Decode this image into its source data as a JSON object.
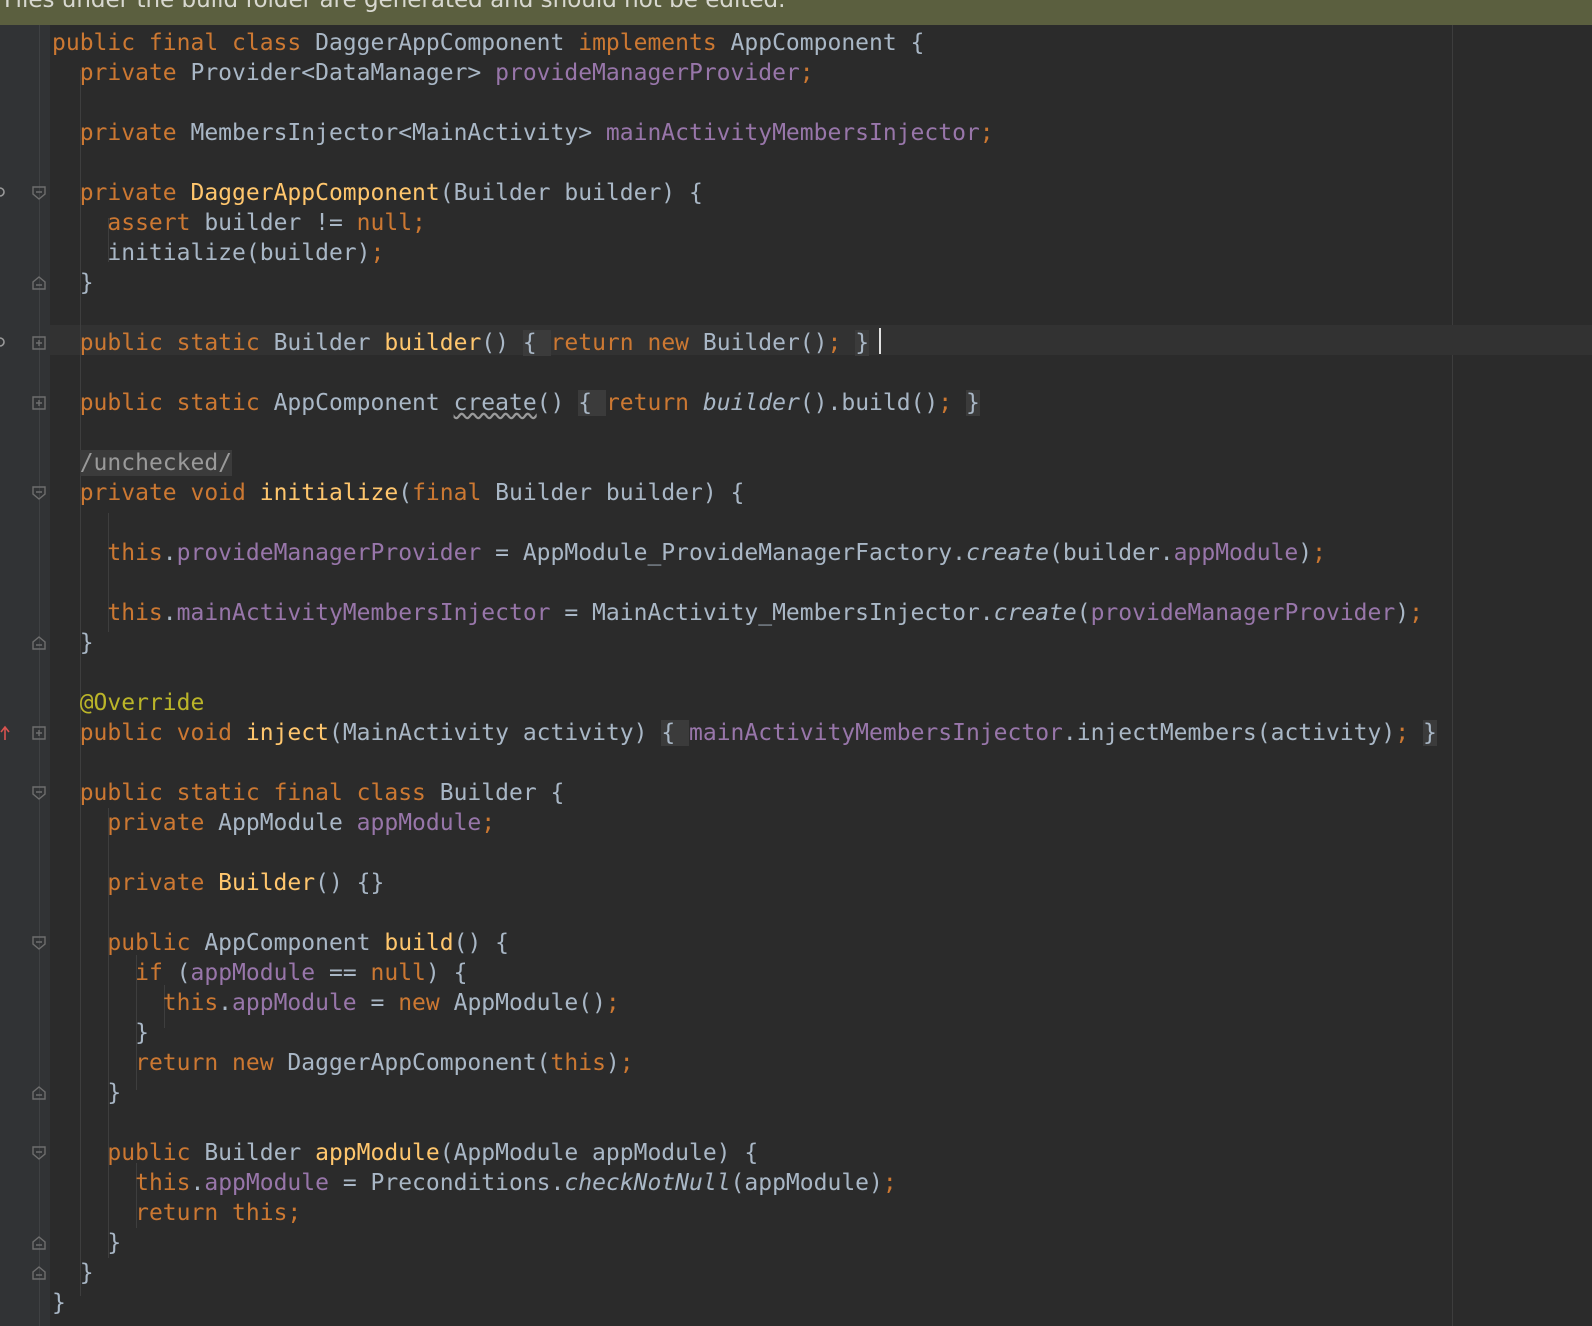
{
  "banner": {
    "text": "Files under the build folder are generated and should not be edited."
  },
  "code_lines": [
    [
      {
        "t": "public final class ",
        "c": "kw"
      },
      {
        "t": "DaggerAppComponent "
      },
      {
        "t": "implements ",
        "c": "kw"
      },
      {
        "t": "AppComponent {"
      }
    ],
    [
      {
        "t": "  "
      },
      {
        "t": "private ",
        "c": "kw"
      },
      {
        "t": "Provider<DataManager> "
      },
      {
        "t": "provideManagerProvider",
        "c": "fld"
      },
      {
        "t": ";",
        "c": "kw"
      }
    ],
    [],
    [
      {
        "t": "  "
      },
      {
        "t": "private ",
        "c": "kw"
      },
      {
        "t": "MembersInjector<MainActivity> "
      },
      {
        "t": "mainActivityMembersInjector",
        "c": "fld"
      },
      {
        "t": ";",
        "c": "kw"
      }
    ],
    [],
    [
      {
        "t": "  "
      },
      {
        "t": "private ",
        "c": "kw"
      },
      {
        "t": "DaggerAppComponent",
        "c": "fn"
      },
      {
        "t": "(Builder builder) {"
      }
    ],
    [
      {
        "t": "    "
      },
      {
        "t": "assert ",
        "c": "kw"
      },
      {
        "t": "builder != "
      },
      {
        "t": "null;",
        "c": "kw"
      }
    ],
    [
      {
        "t": "    initialize(builder)"
      },
      {
        "t": ";",
        "c": "kw"
      }
    ],
    [
      {
        "t": "  }"
      }
    ],
    [],
    [
      {
        "t": "  "
      },
      {
        "t": "public static ",
        "c": "kw"
      },
      {
        "t": "Builder "
      },
      {
        "t": "builder",
        "c": "fn"
      },
      {
        "t": "() "
      },
      {
        "t": "{ ",
        "c": "fold"
      },
      {
        "t": "return new ",
        "c": "kw"
      },
      {
        "t": "Builder()"
      },
      {
        "t": "; ",
        "c": "kw"
      },
      {
        "t": "}",
        "c": "fold"
      }
    ],
    [],
    [
      {
        "t": "  "
      },
      {
        "t": "public static ",
        "c": "kw"
      },
      {
        "t": "AppComponent "
      },
      {
        "t": "create",
        "c": "sq"
      },
      {
        "t": "() "
      },
      {
        "t": "{ ",
        "c": "fold"
      },
      {
        "t": "return ",
        "c": "kw"
      },
      {
        "t": "builder",
        "c": "it"
      },
      {
        "t": "().build()"
      },
      {
        "t": "; ",
        "c": "kw"
      },
      {
        "t": "}",
        "c": "fold"
      }
    ],
    [],
    [
      {
        "t": "  "
      },
      {
        "t": "/unchecked/",
        "c": "cmt"
      }
    ],
    [
      {
        "t": "  "
      },
      {
        "t": "private void ",
        "c": "kw"
      },
      {
        "t": "initialize",
        "c": "fn"
      },
      {
        "t": "("
      },
      {
        "t": "final ",
        "c": "kw"
      },
      {
        "t": "Builder builder) {"
      }
    ],
    [],
    [
      {
        "t": "    "
      },
      {
        "t": "this",
        "c": "kw"
      },
      {
        "t": "."
      },
      {
        "t": "provideManagerProvider",
        "c": "fld"
      },
      {
        "t": " = AppModule_ProvideManagerFactory."
      },
      {
        "t": "create",
        "c": "it"
      },
      {
        "t": "(builder."
      },
      {
        "t": "appModule",
        "c": "fld"
      },
      {
        "t": ")"
      },
      {
        "t": ";",
        "c": "kw"
      }
    ],
    [],
    [
      {
        "t": "    "
      },
      {
        "t": "this",
        "c": "kw"
      },
      {
        "t": "."
      },
      {
        "t": "mainActivityMembersInjector",
        "c": "fld"
      },
      {
        "t": " = MainActivity_MembersInjector."
      },
      {
        "t": "create",
        "c": "it"
      },
      {
        "t": "("
      },
      {
        "t": "provideManagerProvider",
        "c": "fld"
      },
      {
        "t": ")"
      },
      {
        "t": ";",
        "c": "kw"
      }
    ],
    [
      {
        "t": "  }"
      }
    ],
    [],
    [
      {
        "t": "  "
      },
      {
        "t": "@Override",
        "c": "an"
      }
    ],
    [
      {
        "t": "  "
      },
      {
        "t": "public void ",
        "c": "kw"
      },
      {
        "t": "inject",
        "c": "fn"
      },
      {
        "t": "(MainActivity activity) "
      },
      {
        "t": "{ ",
        "c": "fold"
      },
      {
        "t": "mainActivityMembersInjector",
        "c": "fld"
      },
      {
        "t": ".injectMembers(activity)"
      },
      {
        "t": "; ",
        "c": "kw"
      },
      {
        "t": "}",
        "c": "fold"
      }
    ],
    [],
    [
      {
        "t": "  "
      },
      {
        "t": "public static final class ",
        "c": "kw"
      },
      {
        "t": "Builder {"
      }
    ],
    [
      {
        "t": "    "
      },
      {
        "t": "private ",
        "c": "kw"
      },
      {
        "t": "AppModule "
      },
      {
        "t": "appModule",
        "c": "fld"
      },
      {
        "t": ";",
        "c": "kw"
      }
    ],
    [],
    [
      {
        "t": "    "
      },
      {
        "t": "private ",
        "c": "kw"
      },
      {
        "t": "Builder",
        "c": "fn"
      },
      {
        "t": "() {}"
      }
    ],
    [],
    [
      {
        "t": "    "
      },
      {
        "t": "public ",
        "c": "kw"
      },
      {
        "t": "AppComponent "
      },
      {
        "t": "build",
        "c": "fn"
      },
      {
        "t": "() {"
      }
    ],
    [
      {
        "t": "      "
      },
      {
        "t": "if ",
        "c": "kw"
      },
      {
        "t": "("
      },
      {
        "t": "appModule",
        "c": "fld"
      },
      {
        "t": " == "
      },
      {
        "t": "null",
        "c": "kw"
      },
      {
        "t": ") {"
      }
    ],
    [
      {
        "t": "        "
      },
      {
        "t": "this",
        "c": "kw"
      },
      {
        "t": "."
      },
      {
        "t": "appModule",
        "c": "fld"
      },
      {
        "t": " = "
      },
      {
        "t": "new ",
        "c": "kw"
      },
      {
        "t": "AppModule()"
      },
      {
        "t": ";",
        "c": "kw"
      }
    ],
    [
      {
        "t": "      }"
      }
    ],
    [
      {
        "t": "      "
      },
      {
        "t": "return new ",
        "c": "kw"
      },
      {
        "t": "DaggerAppComponent("
      },
      {
        "t": "this",
        "c": "kw"
      },
      {
        "t": ")"
      },
      {
        "t": ";",
        "c": "kw"
      }
    ],
    [
      {
        "t": "    }"
      }
    ],
    [],
    [
      {
        "t": "    "
      },
      {
        "t": "public ",
        "c": "kw"
      },
      {
        "t": "Builder "
      },
      {
        "t": "appModule",
        "c": "fn"
      },
      {
        "t": "(AppModule appModule) {"
      }
    ],
    [
      {
        "t": "      "
      },
      {
        "t": "this",
        "c": "kw"
      },
      {
        "t": "."
      },
      {
        "t": "appModule",
        "c": "fld"
      },
      {
        "t": " = Preconditions."
      },
      {
        "t": "checkNotNull",
        "c": "it"
      },
      {
        "t": "(appModule)"
      },
      {
        "t": ";",
        "c": "kw"
      }
    ],
    [
      {
        "t": "      "
      },
      {
        "t": "return this;",
        "c": "kw"
      }
    ],
    [
      {
        "t": "    }"
      }
    ],
    [
      {
        "t": "  }"
      }
    ],
    [
      {
        "t": "}"
      }
    ]
  ],
  "colors": {
    "background": "#2b2b2b",
    "gutter": "#313335",
    "banner": "#5b5f3f",
    "keyword": "#cc7832",
    "method": "#ffc66d",
    "field": "#9876aa",
    "annotation": "#bbb529",
    "text": "#a9b7c6"
  },
  "gutter_markers": [
    {
      "line": 6,
      "icon": "fold-open-icon",
      "extra": "usage-marker-icon"
    },
    {
      "line": 9,
      "icon": "fold-close-icon"
    },
    {
      "line": 11,
      "icon": "fold-expand-icon",
      "extra": "usage-marker-icon"
    },
    {
      "line": 13,
      "icon": "fold-expand-icon"
    },
    {
      "line": 16,
      "icon": "fold-open-icon"
    },
    {
      "line": 21,
      "icon": "fold-close-icon"
    },
    {
      "line": 24,
      "icon": "fold-expand-icon",
      "extra": "override-arrow-icon"
    },
    {
      "line": 26,
      "icon": "fold-open-icon"
    },
    {
      "line": 31,
      "icon": "fold-open-icon"
    },
    {
      "line": 36,
      "icon": "fold-close-icon"
    },
    {
      "line": 38,
      "icon": "fold-open-icon"
    },
    {
      "line": 41,
      "icon": "fold-close-icon"
    },
    {
      "line": 42,
      "icon": "fold-close-icon"
    }
  ]
}
